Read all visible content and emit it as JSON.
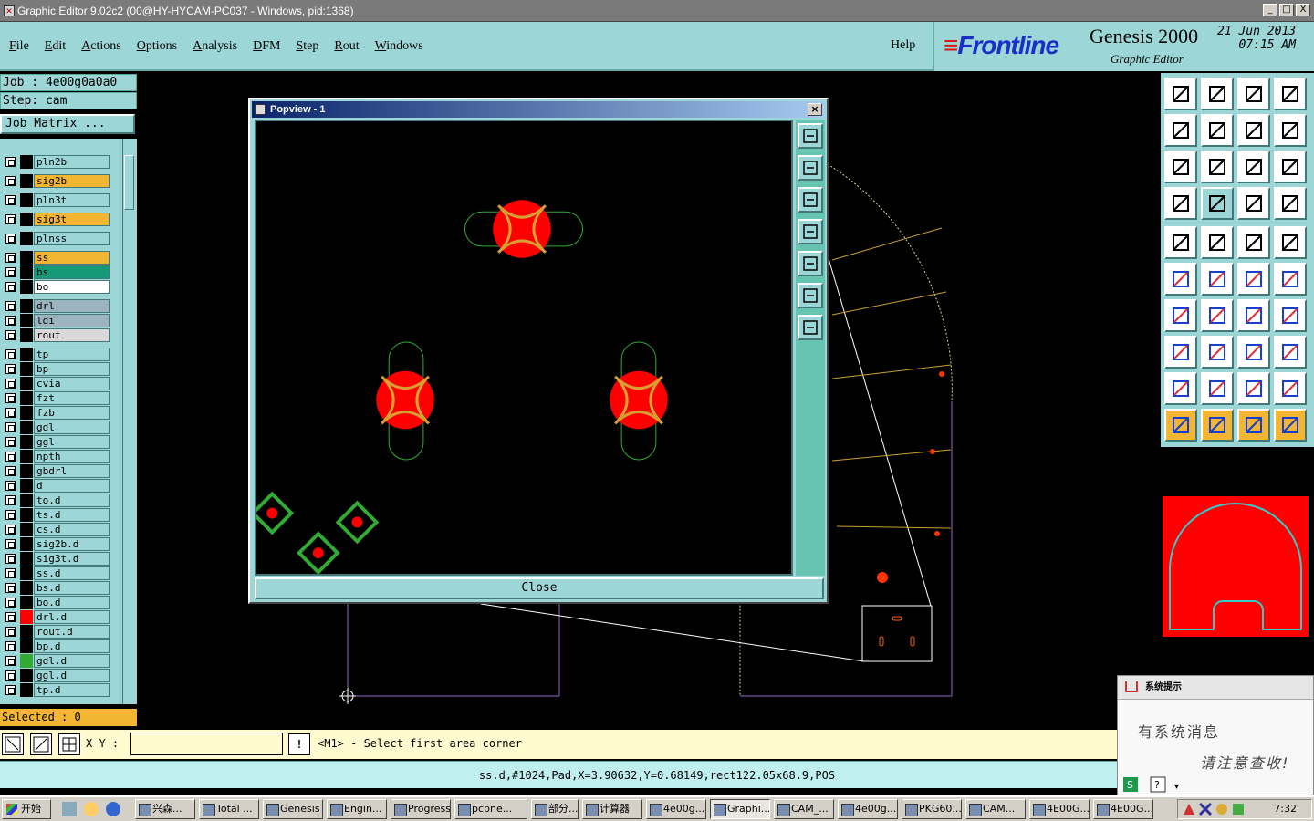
{
  "window": {
    "title": "Graphic Editor 9.02c2 (00@HY-HYCAM-PC037 - Windows, pid:1368)",
    "buttons": [
      "_",
      "□",
      "X"
    ]
  },
  "menu": {
    "items": [
      "File",
      "Edit",
      "Actions",
      "Options",
      "Analysis",
      "DFM",
      "Step",
      "Rout",
      "Windows"
    ],
    "help": "Help"
  },
  "brand": {
    "logo": "Frontline",
    "product": "Genesis 2000",
    "subtitle": "Graphic Editor",
    "date": "21 Jun 2013",
    "time": "07:15 AM"
  },
  "left_panel": {
    "job": "Job : 4e00g0a0a0",
    "step": "Step: cam",
    "job_matrix": "Job Matrix ...",
    "selected": "Selected : 0",
    "layers": [
      {
        "name": "pln2b",
        "color": "#9cd6d6",
        "swatch": "#000000",
        "mark": ""
      },
      {
        "name": "sig2b",
        "color": "#f2b632",
        "swatch": "#000000",
        "mark": "◢"
      },
      {
        "name": "pln3t",
        "color": "#9cd6d6",
        "swatch": "#000000",
        "mark": ""
      },
      {
        "name": "sig3t",
        "color": "#f2b632",
        "swatch": "#000000",
        "mark": ""
      },
      {
        "name": "plnss",
        "color": "#9cd6d6",
        "swatch": "#000000",
        "mark": ""
      },
      {
        "name": "ss",
        "color": "#f2b632",
        "swatch": "#000000",
        "mark": ""
      },
      {
        "name": "bs",
        "color": "#159a78",
        "swatch": "#000000",
        "mark": ""
      },
      {
        "name": "bo",
        "color": "#ffffff",
        "swatch": "#000000",
        "mark": ""
      },
      {
        "name": "drl",
        "color": "#9bb4c0",
        "swatch": "#000000",
        "mark": ""
      },
      {
        "name": "ldi",
        "color": "#9bb4c0",
        "swatch": "#000000",
        "mark": ""
      },
      {
        "name": "rout",
        "color": "#d9d9d9",
        "swatch": "#000000",
        "mark": ""
      },
      {
        "name": "tp",
        "color": "#9cd6d6",
        "swatch": "#000000",
        "mark": ""
      },
      {
        "name": "bp",
        "color": "#9cd6d6",
        "swatch": "#000000",
        "mark": ""
      },
      {
        "name": "cvia",
        "color": "#9cd6d6",
        "swatch": "#000000",
        "mark": ""
      },
      {
        "name": "fzt",
        "color": "#9cd6d6",
        "swatch": "#000000",
        "mark": ""
      },
      {
        "name": "fzb",
        "color": "#9cd6d6",
        "swatch": "#000000",
        "mark": ""
      },
      {
        "name": "gdl",
        "color": "#9cd6d6",
        "swatch": "#000000",
        "mark": "◢"
      },
      {
        "name": "ggl",
        "color": "#9cd6d6",
        "swatch": "#000000",
        "mark": ""
      },
      {
        "name": "npth",
        "color": "#9cd6d6",
        "swatch": "#000000",
        "mark": ""
      },
      {
        "name": "gbdrl",
        "color": "#9cd6d6",
        "swatch": "#000000",
        "mark": ""
      },
      {
        "name": "d",
        "color": "#9cd6d6",
        "swatch": "#000000",
        "mark": ""
      },
      {
        "name": "to.d",
        "color": "#9cd6d6",
        "swatch": "#000000",
        "mark": ""
      },
      {
        "name": "ts.d",
        "color": "#9cd6d6",
        "swatch": "#000000",
        "mark": "◢"
      },
      {
        "name": "cs.d",
        "color": "#9cd6d6",
        "swatch": "#000000",
        "mark": "◢"
      },
      {
        "name": "sig2b.d",
        "color": "#9cd6d6",
        "swatch": "#000000",
        "mark": "◢"
      },
      {
        "name": "sig3t.d",
        "color": "#9cd6d6",
        "swatch": "#000000",
        "mark": ""
      },
      {
        "name": "ss.d",
        "color": "#9cd6d6",
        "swatch": "#000000",
        "mark": ""
      },
      {
        "name": "bs.d",
        "color": "#9cd6d6",
        "swatch": "#000000",
        "mark": ""
      },
      {
        "name": "bo.d",
        "color": "#9cd6d6",
        "swatch": "#000000",
        "mark": ""
      },
      {
        "name": "drl.d",
        "color": "#9cd6d6",
        "swatch": "#ff0000",
        "mark": "▦"
      },
      {
        "name": "rout.d",
        "color": "#9cd6d6",
        "swatch": "#000000",
        "mark": ""
      },
      {
        "name": "bp.d",
        "color": "#9cd6d6",
        "swatch": "#000000",
        "mark": ""
      },
      {
        "name": "gdl.d",
        "color": "#9cd6d6",
        "swatch": "#33aa33",
        "mark": "◢"
      },
      {
        "name": "ggl.d",
        "color": "#9cd6d6",
        "swatch": "#000000",
        "mark": ""
      },
      {
        "name": "tp.d",
        "color": "#9cd6d6",
        "swatch": "#000000",
        "mark": ""
      }
    ]
  },
  "popview": {
    "title": "Popview - 1",
    "close_label": "Close"
  },
  "bottom": {
    "xy_label": "X Y :",
    "xy_value": "",
    "prompt": "<M1> - Select first area corner",
    "status": "ss.d,#1024,Pad,X=3.90632,Y=0.68149,rect122.05x68.9,POS"
  },
  "notification": {
    "title": "系统提示",
    "line1": "有系统消息",
    "line2": "请注意查收!"
  },
  "taskbar": {
    "start": "开始",
    "tasks": [
      "兴森...",
      "Total ...",
      "Genesis",
      "Engin...",
      "Progress",
      "pcbne...",
      "部分...",
      "计算器",
      "4e00g...",
      "Graphi...",
      "CAM_...",
      "4e00g...",
      "PKG60...",
      "CAM...",
      "4E00G...",
      "4E00G..."
    ],
    "active_task": "Graphi...",
    "clock": "7:32"
  },
  "colors": {
    "panel": "#9cd6d6",
    "highlight": "#f2b632",
    "pad": "#ff0000",
    "outline": "#33aa33"
  }
}
